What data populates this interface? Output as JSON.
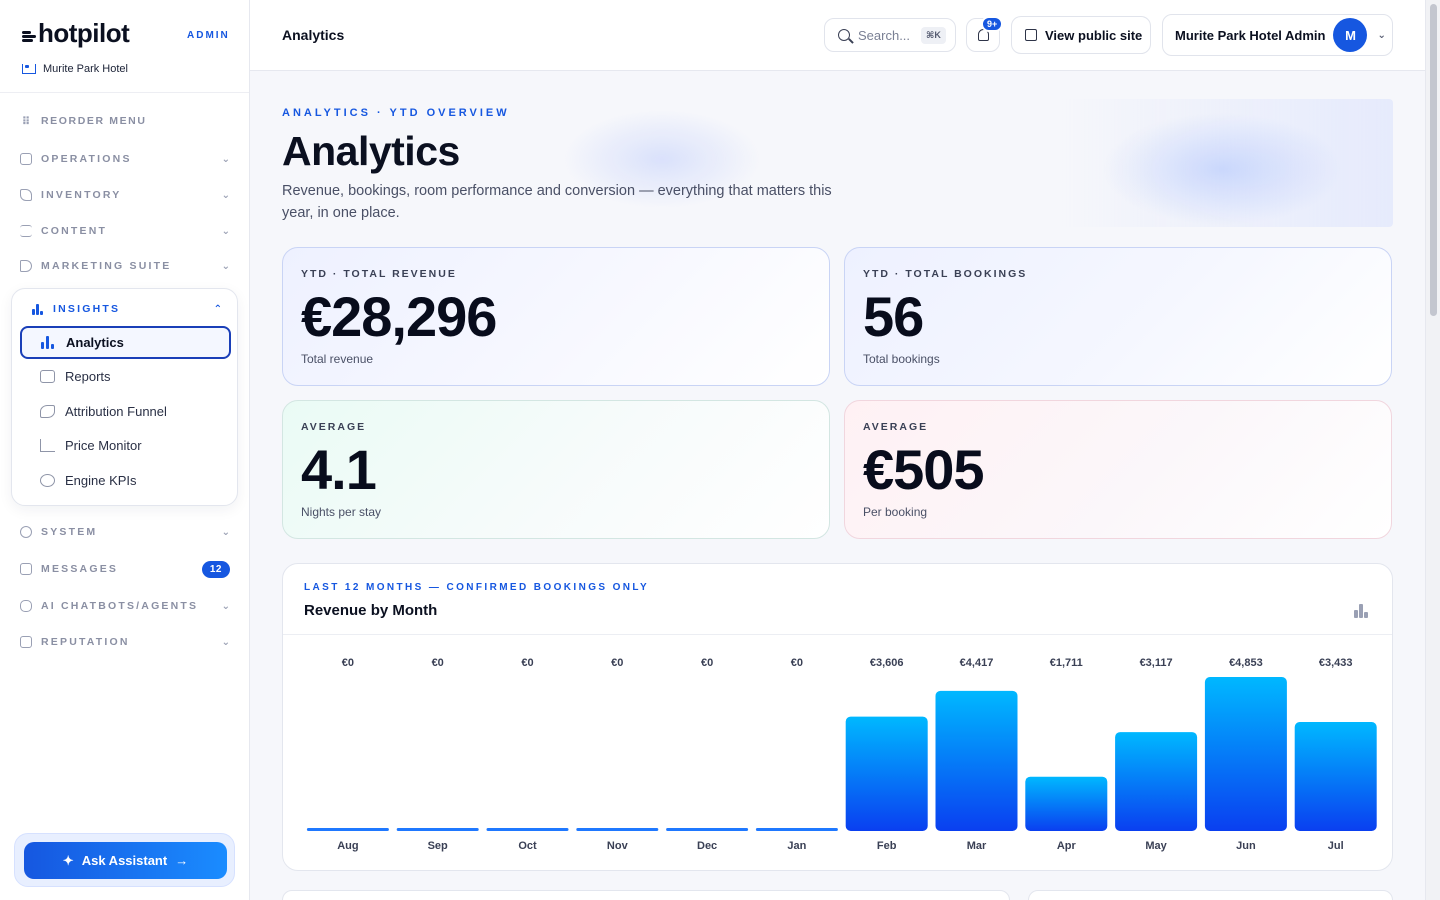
{
  "brand": {
    "name": "hotpilot",
    "tag": "ADMIN",
    "hotel": "Murite Park Hotel"
  },
  "sidebar": {
    "reorder": "REORDER MENU",
    "groups": [
      {
        "label": "OPERATIONS"
      },
      {
        "label": "INVENTORY"
      },
      {
        "label": "CONTENT"
      },
      {
        "label": "MARKETING SUITE"
      }
    ],
    "insights": {
      "label": "INSIGHTS",
      "items": [
        {
          "label": "Analytics"
        },
        {
          "label": "Reports"
        },
        {
          "label": "Attribution Funnel"
        },
        {
          "label": "Price Monitor"
        },
        {
          "label": "Engine KPIs"
        }
      ]
    },
    "lower": [
      {
        "label": "SYSTEM"
      },
      {
        "label": "MESSAGES",
        "badge": "12"
      },
      {
        "label": "AI CHATBOTS/AGENTS"
      },
      {
        "label": "REPUTATION"
      }
    ],
    "assistant": "Ask Assistant"
  },
  "topbar": {
    "title": "Analytics",
    "search_placeholder": "Search...",
    "search_shortcut": "⌘K",
    "notif_badge": "9+",
    "view_site": "View public site",
    "user_name": "Murite Park Hotel Admin",
    "avatar": "M"
  },
  "hero": {
    "eyebrow": "ANALYTICS · YTD OVERVIEW",
    "title": "Analytics",
    "subtitle": "Revenue, bookings, room performance and conversion — everything that matters this year, in one place."
  },
  "kpis": [
    {
      "label": "YTD · TOTAL REVENUE",
      "value": "€28,296",
      "caption": "Total revenue"
    },
    {
      "label": "YTD · TOTAL BOOKINGS",
      "value": "56",
      "caption": "Total bookings"
    },
    {
      "label": "AVERAGE",
      "value": "4.1",
      "caption": "Nights per stay"
    },
    {
      "label": "AVERAGE",
      "value": "€505",
      "caption": "Per booking"
    }
  ],
  "chart": {
    "eyebrow": "LAST 12 MONTHS — CONFIRMED BOOKINGS ONLY",
    "title": "Revenue by Month"
  },
  "chart_data": {
    "type": "bar",
    "title": "Revenue by Month",
    "categories": [
      "Aug",
      "Sep",
      "Oct",
      "Nov",
      "Dec",
      "Jan",
      "Feb",
      "Mar",
      "Apr",
      "May",
      "Jun",
      "Jul"
    ],
    "values": [
      0,
      0,
      0,
      0,
      0,
      0,
      3606,
      4417,
      1711,
      3117,
      4853,
      3433
    ],
    "data_labels": [
      "€0",
      "€0",
      "€0",
      "€0",
      "€0",
      "€0",
      "€3,606",
      "€4,417",
      "€1,711",
      "€3,117",
      "€4,853",
      "€3,433"
    ],
    "grid": false,
    "colors": {
      "bar_top": "#00b8ff",
      "bar_bottom": "#0a3ff0"
    }
  },
  "colors": {
    "accent": "#1657e0",
    "text": "#0b1020"
  }
}
